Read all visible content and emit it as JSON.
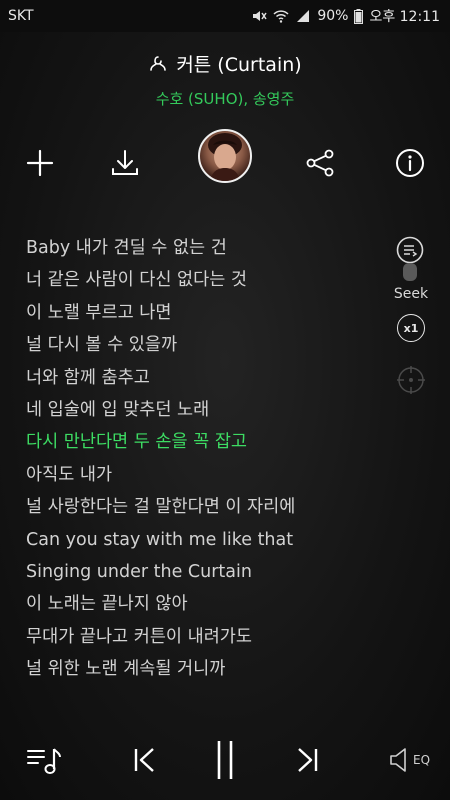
{
  "status": {
    "carrier": "SKT",
    "battery": "90%",
    "time": "오후 12:11"
  },
  "song": {
    "title": "커튼 (Curtain)",
    "artist": "수호 (SUHO), 송영주"
  },
  "actions": {
    "add_icon": "plus-icon",
    "download_icon": "download-icon",
    "share_icon": "share-icon",
    "info_icon": "info-icon"
  },
  "lyrics": [
    "Baby 내가 견딜 수 없는 건",
    "너 같은 사람이 다신 없다는 것",
    "이 노랠 부르고 나면",
    "널 다시 볼 수 있을까",
    "너와 함께 춤추고",
    "네 입술에 입 맞추던 노래",
    "다시 만난다면 두 손을 꼭 잡고",
    "아직도 내가",
    "널 사랑한다는 걸 말한다면 이 자리에",
    "Can you stay with me like that",
    "Singing under the Curtain",
    "이 노래는 끝나지 않아",
    "무대가 끝나고 커튼이 내려가도",
    "널 위한 노랜 계속될 거니까"
  ],
  "active_lyric_index": 6,
  "side": {
    "seek_label": "Seek",
    "speed_label": "x1"
  },
  "player": {
    "eq_label": "EQ"
  },
  "colors": {
    "accent": "#3ddc63",
    "artist": "#34c95b",
    "background": "#141414"
  }
}
